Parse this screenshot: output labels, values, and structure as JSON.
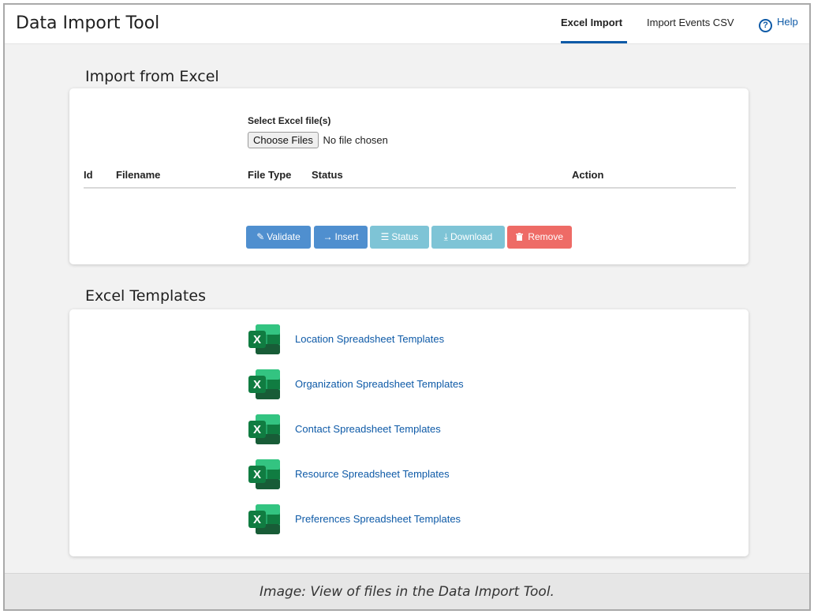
{
  "header": {
    "app_title": "Data Import Tool",
    "tabs": [
      {
        "label": "Excel Import",
        "active": true
      },
      {
        "label": "Import Events CSV",
        "active": false
      }
    ],
    "help_label": "Help",
    "help_glyph": "?"
  },
  "import_section": {
    "title": "Import from Excel",
    "select_label": "Select Excel file(s)",
    "choose_files_label": "Choose Files",
    "no_file_text": "No file chosen",
    "table_headers": [
      "Id",
      "Filename",
      "File Type",
      "Status",
      "Action"
    ],
    "rows": [],
    "buttons": [
      {
        "label": "Validate",
        "icon": "edit-icon",
        "glyph": "✎",
        "color": "#4f8fcf"
      },
      {
        "label": "Insert",
        "icon": "arrow-right-icon",
        "glyph": "→",
        "color": "#4f8fcf"
      },
      {
        "label": "Status",
        "icon": "list-icon",
        "glyph": "☰",
        "color": "#7ec4d6"
      },
      {
        "label": "Download",
        "icon": "download-icon",
        "glyph": "⤓",
        "color": "#7ec4d6"
      },
      {
        "label": "Remove",
        "icon": "trash-icon",
        "glyph": "🗑",
        "color": "#ee6b66"
      }
    ]
  },
  "templates_section": {
    "title": "Excel Templates",
    "items": [
      {
        "label": "Location Spreadsheet Templates",
        "icon": "excel-icon"
      },
      {
        "label": "Organization Spreadsheet Templates",
        "icon": "excel-icon"
      },
      {
        "label": "Contact Spreadsheet Templates",
        "icon": "excel-icon"
      },
      {
        "label": "Resource Spreadsheet Templates",
        "icon": "excel-icon"
      },
      {
        "label": "Preferences Spreadsheet Templates",
        "icon": "excel-icon"
      }
    ]
  },
  "caption": "Image: View of files in the Data Import Tool.",
  "colors": {
    "accent": "#0e5aa7",
    "excel_dark": "#107c41",
    "excel_light": "#21a366"
  }
}
